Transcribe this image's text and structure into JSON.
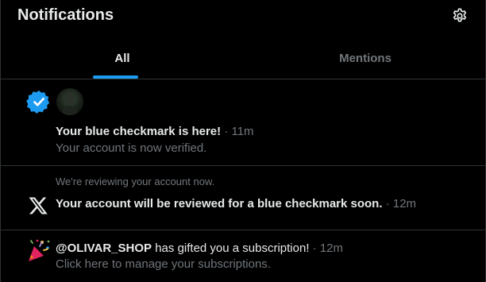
{
  "header": {
    "title": "Notifications",
    "settings_icon": "gear-icon"
  },
  "tabs": [
    {
      "label": "All",
      "active": true
    },
    {
      "label": "Mentions",
      "active": false
    }
  ],
  "accent_color": "#1d9bf0",
  "notifications": [
    {
      "icon": "verified-badge-icon",
      "title": "Your blue checkmark is here!",
      "separator": "·",
      "time": "11m",
      "subtitle": "Your account is now verified."
    },
    {
      "icon": "x-logo-icon",
      "preface": "We're reviewing your account now.",
      "title": "Your account will be reviewed for a blue checkmark soon.",
      "separator": "·",
      "time": "12m"
    },
    {
      "icon": "party-popper-icon",
      "username": "@OLIVAR_SHOP",
      "title_rest": " has gifted you a subscription!",
      "separator": "·",
      "time": "12m",
      "subtitle": "Click here to manage your subscriptions."
    }
  ]
}
